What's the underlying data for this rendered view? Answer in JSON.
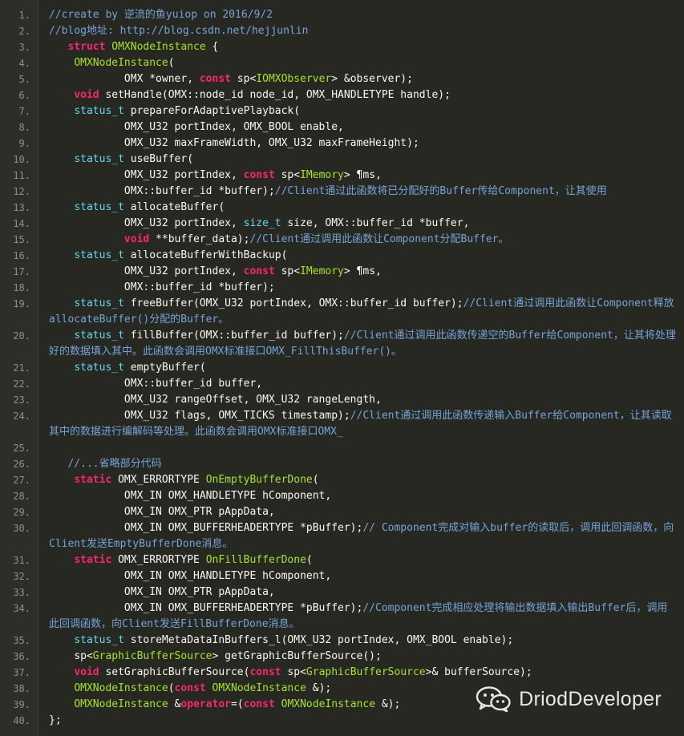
{
  "code": {
    "lines": [
      {
        "n": "1.",
        "segs": [
          {
            "t": "//create by 逆流的鱼yuiop on 2016/9/2",
            "c": "cm"
          }
        ]
      },
      {
        "n": "2.",
        "segs": [
          {
            "t": "//blog地址: http://blog.csdn.net/hejjunlin",
            "c": "cm"
          }
        ]
      },
      {
        "n": "3.",
        "segs": [
          {
            "t": "   "
          },
          {
            "t": "struct",
            "c": "kw"
          },
          {
            "t": " "
          },
          {
            "t": "OMXNodeInstance",
            "c": "fn"
          },
          {
            "t": " {"
          }
        ]
      },
      {
        "n": "4.",
        "segs": [
          {
            "t": "    "
          },
          {
            "t": "OMXNodeInstance",
            "c": "fn"
          },
          {
            "t": "("
          }
        ]
      },
      {
        "n": "5.",
        "segs": [
          {
            "t": "            OMX *owner, "
          },
          {
            "t": "const",
            "c": "kw"
          },
          {
            "t": " sp<"
          },
          {
            "t": "IOMXObserver",
            "c": "fn"
          },
          {
            "t": "> &observer);"
          }
        ]
      },
      {
        "n": "6.",
        "segs": [
          {
            "t": "    "
          },
          {
            "t": "void",
            "c": "kw"
          },
          {
            "t": " setHandle(OMX::node_id node_id, OMX_HANDLETYPE handle);"
          }
        ]
      },
      {
        "n": "7.",
        "segs": [
          {
            "t": "    "
          },
          {
            "t": "status_t",
            "c": "kt"
          },
          {
            "t": " prepareForAdaptivePlayback("
          }
        ]
      },
      {
        "n": "8.",
        "segs": [
          {
            "t": "            OMX_U32 portIndex, OMX_BOOL enable,"
          }
        ]
      },
      {
        "n": "9.",
        "segs": [
          {
            "t": "            OMX_U32 maxFrameWidth, OMX_U32 maxFrameHeight);"
          }
        ]
      },
      {
        "n": "10.",
        "segs": [
          {
            "t": "    "
          },
          {
            "t": "status_t",
            "c": "kt"
          },
          {
            "t": " useBuffer("
          }
        ]
      },
      {
        "n": "11.",
        "segs": [
          {
            "t": "            OMX_U32 portIndex, "
          },
          {
            "t": "const",
            "c": "kw"
          },
          {
            "t": " sp<"
          },
          {
            "t": "IMemory",
            "c": "fn"
          },
          {
            "t": "> ¶ms,"
          }
        ]
      },
      {
        "n": "12.",
        "segs": [
          {
            "t": "            OMX::buffer_id *buffer);"
          },
          {
            "t": "//Client通过此函数将已分配好的Buffer传给Component，让其使用",
            "c": "cm"
          }
        ]
      },
      {
        "n": "13.",
        "segs": [
          {
            "t": "    "
          },
          {
            "t": "status_t",
            "c": "kt"
          },
          {
            "t": " allocateBuffer("
          }
        ]
      },
      {
        "n": "14.",
        "segs": [
          {
            "t": "            OMX_U32 portIndex, "
          },
          {
            "t": "size_t",
            "c": "kt"
          },
          {
            "t": " size, OMX::buffer_id *buffer,"
          }
        ]
      },
      {
        "n": "15.",
        "segs": [
          {
            "t": "            "
          },
          {
            "t": "void",
            "c": "kw"
          },
          {
            "t": " **buffer_data);"
          },
          {
            "t": "//Client通过调用此函数让Component分配Buffer。",
            "c": "cm"
          }
        ]
      },
      {
        "n": "16.",
        "segs": [
          {
            "t": "    "
          },
          {
            "t": "status_t",
            "c": "kt"
          },
          {
            "t": " allocateBufferWithBackup("
          }
        ]
      },
      {
        "n": "17.",
        "segs": [
          {
            "t": "            OMX_U32 portIndex, "
          },
          {
            "t": "const",
            "c": "kw"
          },
          {
            "t": " sp<"
          },
          {
            "t": "IMemory",
            "c": "fn"
          },
          {
            "t": "> ¶ms,"
          }
        ]
      },
      {
        "n": "18.",
        "segs": [
          {
            "t": "            OMX::buffer_id *buffer);"
          }
        ]
      },
      {
        "n": "19.",
        "segs": [
          {
            "t": "    "
          },
          {
            "t": "status_t",
            "c": "kt"
          },
          {
            "t": " freeBuffer(OMX_U32 portIndex, OMX::buffer_id buffer);"
          },
          {
            "t": "//Client通过调用此函数让Component释放allocateBuffer()分配的Buffer。",
            "c": "cm"
          }
        ]
      },
      {
        "n": "20.",
        "segs": [
          {
            "t": "    "
          },
          {
            "t": "status_t",
            "c": "kt"
          },
          {
            "t": " fillBuffer(OMX::buffer_id buffer);"
          },
          {
            "t": "//Client通过调用此函数传递空的Buffer给Component，让其将处理好的数据填入其中。此函数会调用OMX标准接口OMX_FillThisBuffer()。",
            "c": "cm"
          }
        ]
      },
      {
        "n": "21.",
        "segs": [
          {
            "t": "    "
          },
          {
            "t": "status_t",
            "c": "kt"
          },
          {
            "t": " emptyBuffer("
          }
        ]
      },
      {
        "n": "22.",
        "segs": [
          {
            "t": "            OMX::buffer_id buffer,"
          }
        ]
      },
      {
        "n": "23.",
        "segs": [
          {
            "t": "            OMX_U32 rangeOffset, OMX_U32 rangeLength,"
          }
        ]
      },
      {
        "n": "24.",
        "segs": [
          {
            "t": "            OMX_U32 flags, OMX_TICKS timestamp);"
          },
          {
            "t": "//Client通过调用此函数传递输入Buffer给Component，让其读取其中的数据进行编解码等处理。此函数会调用OMX标准接口OMX_",
            "c": "cm"
          }
        ]
      },
      {
        "n": "25.",
        "segs": [
          {
            "t": " "
          }
        ]
      },
      {
        "n": "26.",
        "segs": [
          {
            "t": "   "
          },
          {
            "t": "//...省略部分代码",
            "c": "cm"
          }
        ]
      },
      {
        "n": "27.",
        "segs": [
          {
            "t": "    "
          },
          {
            "t": "static",
            "c": "kw"
          },
          {
            "t": " OMX_ERRORTYPE "
          },
          {
            "t": "OnEmptyBufferDone",
            "c": "fn"
          },
          {
            "t": "("
          }
        ]
      },
      {
        "n": "28.",
        "segs": [
          {
            "t": "            OMX_IN OMX_HANDLETYPE hComponent,"
          }
        ]
      },
      {
        "n": "29.",
        "segs": [
          {
            "t": "            OMX_IN OMX_PTR pAppData,"
          }
        ]
      },
      {
        "n": "30.",
        "segs": [
          {
            "t": "            OMX_IN OMX_BUFFERHEADERTYPE *pBuffer);"
          },
          {
            "t": "// Component完成对输入buffer的读取后，调用此回调函数，向Client发送EmptyBufferDone消息。",
            "c": "cm"
          }
        ]
      },
      {
        "n": "31.",
        "segs": [
          {
            "t": "    "
          },
          {
            "t": "static",
            "c": "kw"
          },
          {
            "t": " OMX_ERRORTYPE "
          },
          {
            "t": "OnFillBufferDone",
            "c": "fn"
          },
          {
            "t": "("
          }
        ]
      },
      {
        "n": "32.",
        "segs": [
          {
            "t": "            OMX_IN OMX_HANDLETYPE hComponent,"
          }
        ]
      },
      {
        "n": "33.",
        "segs": [
          {
            "t": "            OMX_IN OMX_PTR pAppData,"
          }
        ]
      },
      {
        "n": "34.",
        "segs": [
          {
            "t": "            OMX_IN OMX_BUFFERHEADERTYPE *pBuffer);"
          },
          {
            "t": "//Component完成相应处理将输出数据填入输出Buffer后，调用此回调函数，向Client发送FillBufferDone消息。",
            "c": "cm"
          }
        ]
      },
      {
        "n": "35.",
        "segs": [
          {
            "t": "    "
          },
          {
            "t": "status_t",
            "c": "kt"
          },
          {
            "t": " storeMetaDataInBuffers_l(OMX_U32 portIndex, OMX_BOOL enable);"
          }
        ]
      },
      {
        "n": "36.",
        "segs": [
          {
            "t": "    sp<"
          },
          {
            "t": "GraphicBufferSource",
            "c": "fn"
          },
          {
            "t": "> getGraphicBufferSource();"
          }
        ]
      },
      {
        "n": "37.",
        "segs": [
          {
            "t": "    "
          },
          {
            "t": "void",
            "c": "kw"
          },
          {
            "t": " setGraphicBufferSource("
          },
          {
            "t": "const",
            "c": "kw"
          },
          {
            "t": " sp<"
          },
          {
            "t": "GraphicBufferSource",
            "c": "fn"
          },
          {
            "t": ">& bufferSource);"
          }
        ]
      },
      {
        "n": "38.",
        "segs": [
          {
            "t": "    "
          },
          {
            "t": "OMXNodeInstance",
            "c": "fn"
          },
          {
            "t": "("
          },
          {
            "t": "const",
            "c": "kw"
          },
          {
            "t": " "
          },
          {
            "t": "OMXNodeInstance",
            "c": "fn"
          },
          {
            "t": " &);"
          }
        ]
      },
      {
        "n": "39.",
        "segs": [
          {
            "t": "    "
          },
          {
            "t": "OMXNodeInstance",
            "c": "fn"
          },
          {
            "t": " &"
          },
          {
            "t": "operator",
            "c": "kw"
          },
          {
            "t": "=("
          },
          {
            "t": "const",
            "c": "kw"
          },
          {
            "t": " "
          },
          {
            "t": "OMXNodeInstance",
            "c": "fn"
          },
          {
            "t": " &);"
          }
        ]
      },
      {
        "n": "40.",
        "segs": [
          {
            "t": "};"
          }
        ]
      }
    ]
  },
  "watermark": {
    "text": "DriodDeveloper",
    "icon": "wechat-icon"
  },
  "colors": {
    "background": "#272822",
    "gutter": "#2d2e28",
    "keyword": "#f92672",
    "type": "#66d9ef",
    "identifier": "#a6e22e",
    "comment": "#75a3d8",
    "text": "#f8f8f2"
  }
}
